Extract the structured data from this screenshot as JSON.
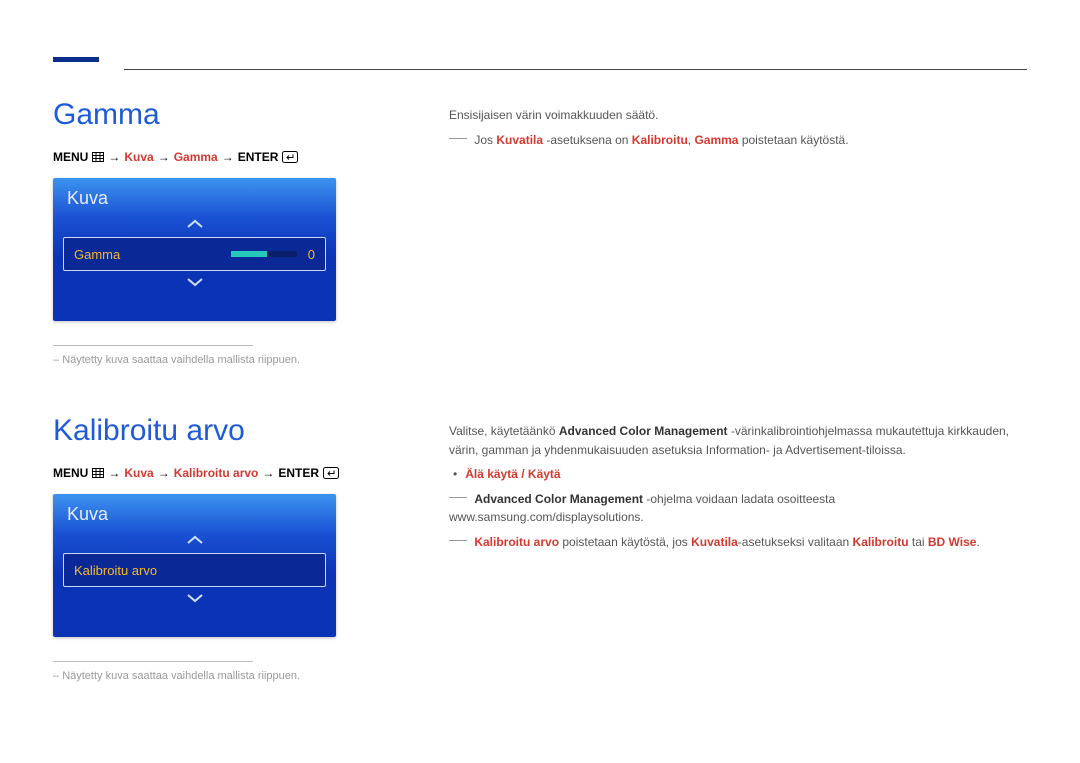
{
  "section1": {
    "heading": "Gamma",
    "menu_path": {
      "menu_word": "MENU",
      "kuva": "Kuva",
      "item": "Gamma",
      "enter_word": "ENTER",
      "arrow": "→"
    },
    "osd": {
      "title": "Kuva",
      "row_label": "Gamma",
      "value": "0"
    },
    "footnote": "Näytetty kuva saattaa vaihdella mallista riippuen.",
    "body": {
      "p1": "Ensisijaisen värin voimakkuuden säätö.",
      "note_pre": "Jos ",
      "note_b1": "Kuvatila",
      "note_mid1": " -asetuksena on ",
      "note_b2": "Kalibroitu",
      "note_mid2": ", ",
      "note_b3": "Gamma",
      "note_post": " poistetaan käytöstä."
    }
  },
  "section2": {
    "heading": "Kalibroitu arvo",
    "menu_path": {
      "menu_word": "MENU",
      "kuva": "Kuva",
      "item": "Kalibroitu arvo",
      "enter_word": "ENTER",
      "arrow": "→"
    },
    "osd": {
      "title": "Kuva",
      "row_label": "Kalibroitu arvo"
    },
    "footnote": "Näytetty kuva saattaa vaihdella mallista riippuen.",
    "body": {
      "p1_pre": "Valitse, käytetäänkö ",
      "p1_b1": "Advanced Color Management",
      "p1_post": " -värinkalibrointiohjelmassa mukautettuja kirkkauden, värin, gamman ja yhdenmukaisuuden asetuksia Information- ja Advertisement-tiloissa.",
      "bullet": "Älä käytä / Käytä",
      "note1_b1": "Advanced Color Management",
      "note1_post": " -ohjelma voidaan ladata osoitteesta www.samsung.com/displaysolutions.",
      "note2_b1": "Kalibroitu arvo",
      "note2_mid1": " poistetaan käytöstä, jos ",
      "note2_b2": "Kuvatila",
      "note2_mid2": "-asetukseksi valitaan ",
      "note2_b3": "Kalibroitu",
      "note2_mid3": " tai ",
      "note2_b4": "BD Wise",
      "note2_end": "."
    }
  }
}
